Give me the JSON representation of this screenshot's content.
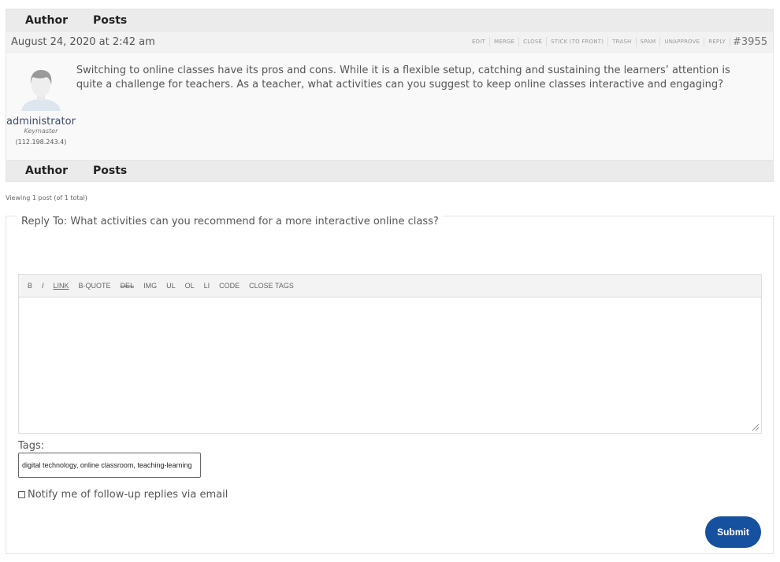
{
  "forum_header": {
    "author_label": "Author",
    "posts_label": "Posts"
  },
  "post": {
    "date": "August 24, 2020 at 2:42 am",
    "id": "#3955",
    "admin_links": [
      "Edit",
      "Merge",
      "Close",
      "Stick (To Front)",
      "Trash",
      "Spam",
      "Unapprove",
      "Reply"
    ],
    "author": {
      "name": "administrator",
      "role": "Keymaster",
      "ip": "(112.198.243.4)",
      "avatar_icon": "default-user-avatar"
    },
    "content": "Switching to online classes have its pros and cons. While it is a flexible setup, catching and sustaining the learners’ attention is quite a challenge for teachers. As a teacher, what activities can you suggest to keep online classes interactive and engaging?"
  },
  "forum_footer": {
    "author_label": "Author",
    "posts_label": "Posts"
  },
  "pagination": "Viewing 1 post (of 1 total)",
  "reply_form": {
    "legend": "Reply To: What activities can you recommend for a more interactive online class?",
    "quicktags": [
      "b",
      "i",
      "link",
      "b-quote",
      "del",
      "img",
      "ul",
      "ol",
      "li",
      "code",
      "close tags"
    ],
    "editor_value": "",
    "tags_label": "Tags:",
    "tags_value": "digital technology, online classroom, teaching-learning",
    "notify_label": "Notify me of follow-up replies via email",
    "notify_checked": false,
    "submit_label": "Submit"
  },
  "colors": {
    "submit": "#1651a0",
    "author_link": "#3b4a6b",
    "header_bg": "#ebebeb"
  }
}
